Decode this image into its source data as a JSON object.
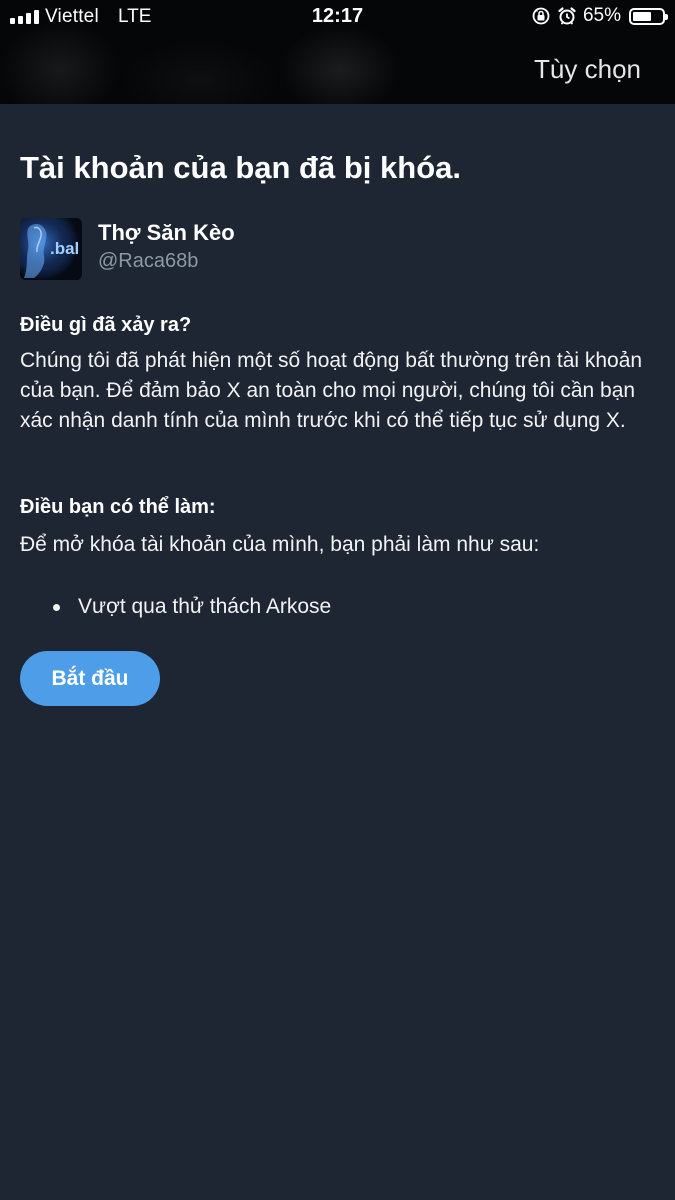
{
  "status_bar": {
    "carrier": "Viettel",
    "network": "LTE",
    "time": "12:17",
    "battery_percent": "65%",
    "battery_level": 0.65,
    "icons": [
      "signal-icon",
      "orientation-lock-icon",
      "alarm-icon",
      "battery-icon"
    ]
  },
  "nav": {
    "options_label": "Tùy chọn"
  },
  "page": {
    "title": "Tài khoản của bạn đã bị khóa."
  },
  "account": {
    "name": "Thợ Săn Kèo",
    "handle": "@Raca68b",
    "avatar_text": ".bal"
  },
  "what_happened": {
    "heading": "Điều gì đã xảy ra?",
    "body": "Chúng tôi đã phát hiện một số hoạt động bất thường trên tài khoản của bạn. Để đảm bảo X an toàn cho mọi người, chúng tôi cần bạn xác nhận danh tính của mình trước khi có thể tiếp tục sử dụng X."
  },
  "what_you_can_do": {
    "heading": "Điều bạn có thể làm:",
    "body": "Để mở khóa tài khoản của mình, bạn phải làm như sau:",
    "steps": [
      "Vượt qua thử thách Arkose"
    ]
  },
  "actions": {
    "start_label": "Bắt đầu"
  },
  "colors": {
    "background": "#1f2633",
    "accent": "#4d9de8",
    "handle": "#8b98a5"
  }
}
